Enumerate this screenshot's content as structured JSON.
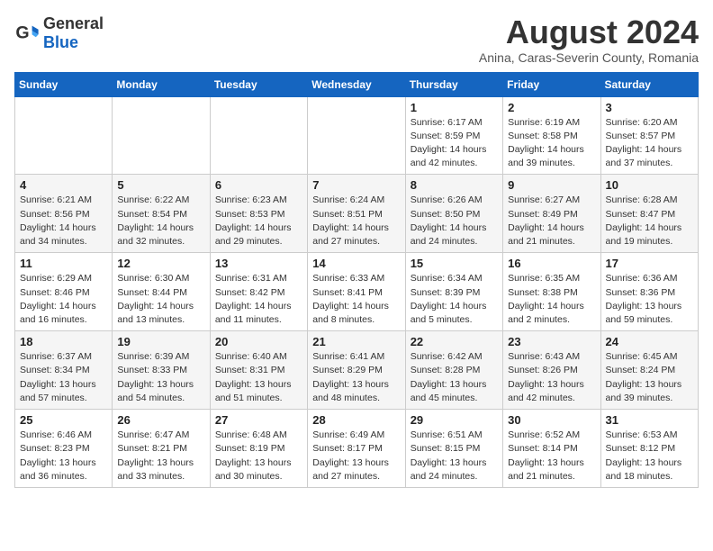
{
  "logo": {
    "text_general": "General",
    "text_blue": "Blue"
  },
  "title": "August 2024",
  "subtitle": "Anina, Caras-Severin County, Romania",
  "headers": [
    "Sunday",
    "Monday",
    "Tuesday",
    "Wednesday",
    "Thursday",
    "Friday",
    "Saturday"
  ],
  "weeks": [
    [
      {
        "day": "",
        "info": ""
      },
      {
        "day": "",
        "info": ""
      },
      {
        "day": "",
        "info": ""
      },
      {
        "day": "",
        "info": ""
      },
      {
        "day": "1",
        "info": "Sunrise: 6:17 AM\nSunset: 8:59 PM\nDaylight: 14 hours\nand 42 minutes."
      },
      {
        "day": "2",
        "info": "Sunrise: 6:19 AM\nSunset: 8:58 PM\nDaylight: 14 hours\nand 39 minutes."
      },
      {
        "day": "3",
        "info": "Sunrise: 6:20 AM\nSunset: 8:57 PM\nDaylight: 14 hours\nand 37 minutes."
      }
    ],
    [
      {
        "day": "4",
        "info": "Sunrise: 6:21 AM\nSunset: 8:56 PM\nDaylight: 14 hours\nand 34 minutes."
      },
      {
        "day": "5",
        "info": "Sunrise: 6:22 AM\nSunset: 8:54 PM\nDaylight: 14 hours\nand 32 minutes."
      },
      {
        "day": "6",
        "info": "Sunrise: 6:23 AM\nSunset: 8:53 PM\nDaylight: 14 hours\nand 29 minutes."
      },
      {
        "day": "7",
        "info": "Sunrise: 6:24 AM\nSunset: 8:51 PM\nDaylight: 14 hours\nand 27 minutes."
      },
      {
        "day": "8",
        "info": "Sunrise: 6:26 AM\nSunset: 8:50 PM\nDaylight: 14 hours\nand 24 minutes."
      },
      {
        "day": "9",
        "info": "Sunrise: 6:27 AM\nSunset: 8:49 PM\nDaylight: 14 hours\nand 21 minutes."
      },
      {
        "day": "10",
        "info": "Sunrise: 6:28 AM\nSunset: 8:47 PM\nDaylight: 14 hours\nand 19 minutes."
      }
    ],
    [
      {
        "day": "11",
        "info": "Sunrise: 6:29 AM\nSunset: 8:46 PM\nDaylight: 14 hours\nand 16 minutes."
      },
      {
        "day": "12",
        "info": "Sunrise: 6:30 AM\nSunset: 8:44 PM\nDaylight: 14 hours\nand 13 minutes."
      },
      {
        "day": "13",
        "info": "Sunrise: 6:31 AM\nSunset: 8:42 PM\nDaylight: 14 hours\nand 11 minutes."
      },
      {
        "day": "14",
        "info": "Sunrise: 6:33 AM\nSunset: 8:41 PM\nDaylight: 14 hours\nand 8 minutes."
      },
      {
        "day": "15",
        "info": "Sunrise: 6:34 AM\nSunset: 8:39 PM\nDaylight: 14 hours\nand 5 minutes."
      },
      {
        "day": "16",
        "info": "Sunrise: 6:35 AM\nSunset: 8:38 PM\nDaylight: 14 hours\nand 2 minutes."
      },
      {
        "day": "17",
        "info": "Sunrise: 6:36 AM\nSunset: 8:36 PM\nDaylight: 13 hours\nand 59 minutes."
      }
    ],
    [
      {
        "day": "18",
        "info": "Sunrise: 6:37 AM\nSunset: 8:34 PM\nDaylight: 13 hours\nand 57 minutes."
      },
      {
        "day": "19",
        "info": "Sunrise: 6:39 AM\nSunset: 8:33 PM\nDaylight: 13 hours\nand 54 minutes."
      },
      {
        "day": "20",
        "info": "Sunrise: 6:40 AM\nSunset: 8:31 PM\nDaylight: 13 hours\nand 51 minutes."
      },
      {
        "day": "21",
        "info": "Sunrise: 6:41 AM\nSunset: 8:29 PM\nDaylight: 13 hours\nand 48 minutes."
      },
      {
        "day": "22",
        "info": "Sunrise: 6:42 AM\nSunset: 8:28 PM\nDaylight: 13 hours\nand 45 minutes."
      },
      {
        "day": "23",
        "info": "Sunrise: 6:43 AM\nSunset: 8:26 PM\nDaylight: 13 hours\nand 42 minutes."
      },
      {
        "day": "24",
        "info": "Sunrise: 6:45 AM\nSunset: 8:24 PM\nDaylight: 13 hours\nand 39 minutes."
      }
    ],
    [
      {
        "day": "25",
        "info": "Sunrise: 6:46 AM\nSunset: 8:23 PM\nDaylight: 13 hours\nand 36 minutes."
      },
      {
        "day": "26",
        "info": "Sunrise: 6:47 AM\nSunset: 8:21 PM\nDaylight: 13 hours\nand 33 minutes."
      },
      {
        "day": "27",
        "info": "Sunrise: 6:48 AM\nSunset: 8:19 PM\nDaylight: 13 hours\nand 30 minutes."
      },
      {
        "day": "28",
        "info": "Sunrise: 6:49 AM\nSunset: 8:17 PM\nDaylight: 13 hours\nand 27 minutes."
      },
      {
        "day": "29",
        "info": "Sunrise: 6:51 AM\nSunset: 8:15 PM\nDaylight: 13 hours\nand 24 minutes."
      },
      {
        "day": "30",
        "info": "Sunrise: 6:52 AM\nSunset: 8:14 PM\nDaylight: 13 hours\nand 21 minutes."
      },
      {
        "day": "31",
        "info": "Sunrise: 6:53 AM\nSunset: 8:12 PM\nDaylight: 13 hours\nand 18 minutes."
      }
    ]
  ]
}
